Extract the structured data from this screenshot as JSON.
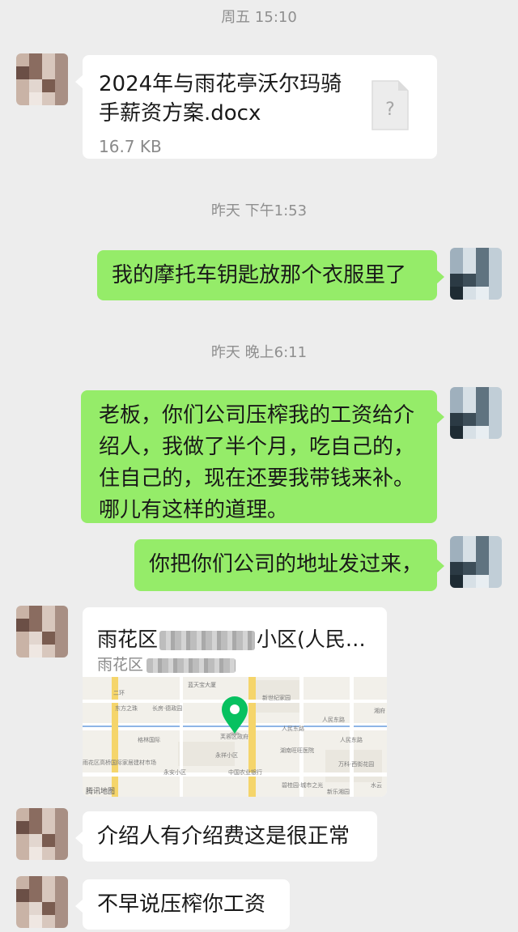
{
  "timestamps": [
    "周五 15:10",
    "昨天 下午1:53",
    "昨天 晚上6:11"
  ],
  "file_message": {
    "name": "2024年与雨花亭沃尔玛骑手薪资方案.docx",
    "size": "16.7 KB",
    "icon": "unknown-file-icon"
  },
  "messages": {
    "m1": "我的摩托车钥匙放那个衣服里了",
    "m2": "老板，你们公司压榨我的工资给介绍人，我做了半个月，吃自己的，住自己的，现在还要我带钱来补。哪儿有这样的道理。",
    "m3": "你把你们公司的地址发过来，",
    "m4": "介绍人有介绍费这是很正常",
    "m5": "不早说压榨你工资"
  },
  "location": {
    "title_prefix": "雨花区",
    "title_suffix": "小区(人民…",
    "subtitle_prefix": "雨花区",
    "map_labels": {
      "l1": "蓝天宝大厦",
      "l2": "新世纪家园",
      "l3": "东方之珠",
      "l4": "长房·德政园",
      "l5": "人民东路",
      "l6": "人民东路",
      "l7": "格林国际",
      "l8": "芙蓉区政府",
      "l9": "湖南旺旺医院",
      "l10": "雨花区高桥国际家居建材市场",
      "l11": "永祥小区",
      "l12": "永安小区",
      "l13": "中国农业银行",
      "l14": "万科·西街花园",
      "l15": "碧桂园·城市之光",
      "l16": "腾讯地图",
      "l17": "人民东路",
      "l18": "新乐湘园",
      "l19": "水云",
      "l20": "二环",
      "l21": "湘府"
    }
  },
  "colors": {
    "background": "#ededed",
    "sent_bubble": "#95ec69",
    "received_bubble": "#ffffff",
    "timestamp": "#8f8f8f",
    "pin": "#07c160"
  }
}
